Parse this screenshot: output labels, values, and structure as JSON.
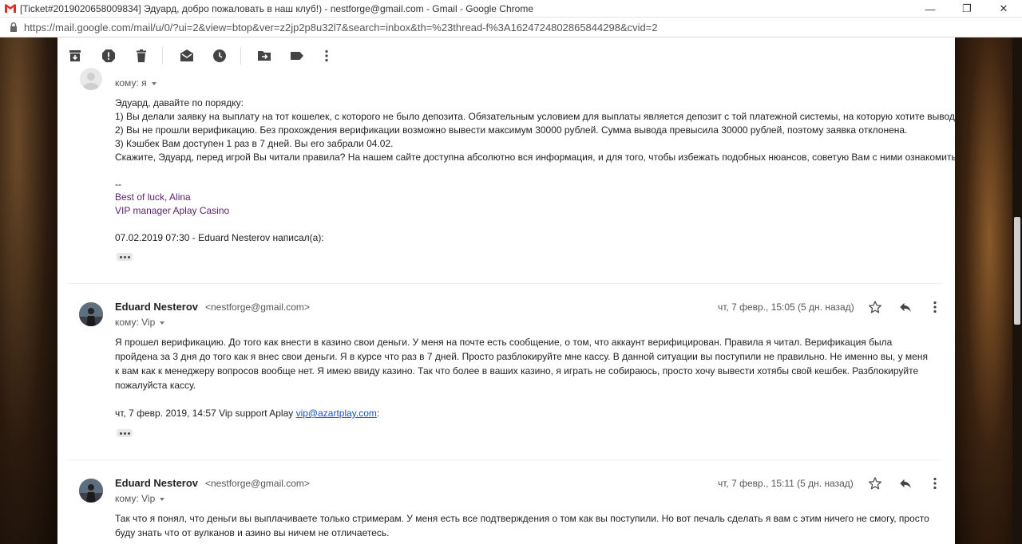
{
  "window": {
    "title": "[Ticket#2019020658009834] Эдуард, добро пожаловать в наш клуб!) - nestforge@gmail.com - Gmail - Google Chrome",
    "minimize": "—",
    "maximize": "❐",
    "close": "✕"
  },
  "address": {
    "url": "https://mail.google.com/mail/u/0/?ui=2&view=btop&ver=z2jp2p8u32l7&search=inbox&th=%23thread-f%3A1624724802865844298&cvid=2"
  },
  "toolbar": {
    "icons": [
      "archive-icon",
      "report-spam-icon",
      "delete-icon",
      "mark-unread-icon",
      "snooze-icon",
      "move-to-icon",
      "label-icon",
      "more-icon"
    ]
  },
  "message1": {
    "to_label": "кому: я",
    "lines": [
      " Эдуард, давайте по порядку:",
      "1) Вы делали заявку на выплату на тот кошелек, с которого не было депозита. Обязательным условием для выплаты является депозит с той платежной системы, на которую хотите выводить.",
      "2) Вы не прошли верификацию. Без прохождения верификации возможно вывести максимум 30000 рублей. Сумма вывода превысила 30000 рублей, поэтому заявка отклонена.",
      "3) Кэшбек Вам доступен 1 раз в 7 дней. Вы его забрали 04.02.",
      " Скажите, Эдуард, перед игрой Вы читали правила? На нашем сайте доступна абсолютно вся информация, и для того, чтобы избежать подобных нюансов, советую Вам с ними ознакомиться."
    ],
    "sig_dash": "--",
    "sig_name": "Best of luck, Alina",
    "sig_title": "VIP manager Aplay Casino",
    "quote_header": "07.02.2019 07:30 - Eduard Nesterov написал(а):"
  },
  "message2": {
    "sender": "Eduard Nesterov",
    "email": "<nestforge@gmail.com>",
    "to_label": "кому: Vip",
    "date": "чт, 7 февр., 15:05 (5 дн. назад)",
    "lines": [
      "Я прошел верификацию. До того как внести в казино свои деньги. У меня на почте есть сообщение, о том, что аккаунт верифицирован. Правила я читал.  Верификация была",
      "пройдена за 3 дня до того как я внес свои деньги. Я в курсе что раз в 7 дней. Просто разблокируйте мне кассу. В данной ситуации вы поступили не правильно. Не именно вы, у меня",
      "к вам как к менеджеру вопросов вообще нет. Я имею ввиду казино. Так что более в ваших казино, я играть не собираюсь, просто хочу вывести хотябы свой кешбек. Разблокируйте",
      "пожалуйста кассу."
    ],
    "quote_prefix": "чт, 7 февр. 2019, 14:57 Vip support Aplay ",
    "quote_link": "vip@azartplay.com",
    "quote_suffix": ":"
  },
  "message3": {
    "sender": "Eduard Nesterov",
    "email": "<nestforge@gmail.com>",
    "to_label": "кому: Vip",
    "date": "чт, 7 февр., 15:11 (5 дн. назад)",
    "lines": [
      "Так что я понял, что деньги вы выплачиваете только стримерам. У меня есть все подтверждения о том как вы поступили. Но вот печаль сделать я вам с этим ничего не смогу, просто",
      "буду знать что от вулканов и азино вы ничем не отличаетесь."
    ]
  },
  "colors": {
    "signature": "#5b1f6b",
    "link": "#1a55c0",
    "gmail_red": "#d93025"
  }
}
